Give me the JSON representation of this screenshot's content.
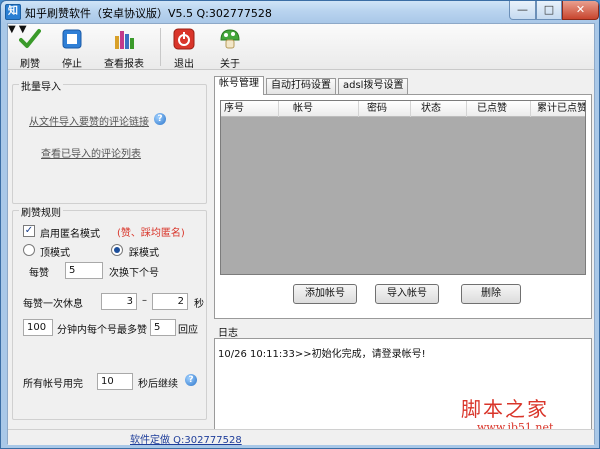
{
  "window": {
    "app_icon_text": "知",
    "title": "知乎刷赞软件（安卓协议版）V5.5   Q:302777528",
    "min_symbol": "—",
    "max_symbol": "□",
    "close_symbol": "✕"
  },
  "toolbar": {
    "items": [
      {
        "label": "刷赞",
        "icon": "checkmark-icon",
        "color": "#3a9a2a"
      },
      {
        "label": "停止",
        "icon": "stop-icon",
        "color": "#2f7fd6"
      },
      {
        "label": "查看报表",
        "icon": "bar-chart-icon",
        "color": "#c23a8a"
      },
      {
        "label": "退出",
        "icon": "power-icon",
        "color": "#d9352a"
      },
      {
        "label": "关于",
        "icon": "mushroom-icon",
        "color": "#43a63a"
      }
    ],
    "dropdown_symbol": "▼"
  },
  "batch_import": {
    "title": "批量导入",
    "import_link": "从文件导入要赞的评论链接",
    "help_symbol": "?",
    "view_link": "查看已导入的评论列表"
  },
  "rules": {
    "title": "刷赞规则",
    "anonymous_label": "启用匿名模式",
    "anonymous_checked": true,
    "anonymous_note": "(赞、踩均匿名)",
    "check_symbol": "✓",
    "mode_up": "顶模式",
    "mode_down": "踩模式",
    "selected_mode": "踩模式",
    "per_like_label": "每赞",
    "per_like_value": "5",
    "per_like_suffix": "次换下个号",
    "rest_label": "每赞一次休息",
    "rest_min": "3",
    "rest_dash": "–",
    "rest_max": "2",
    "rest_unit": "秒",
    "limit_value": "100",
    "limit_middle": "分钟内每个号最多赞",
    "limit_count": "5",
    "limit_suffix": "回应",
    "continue_label": "所有帐号用完",
    "continue_value": "10",
    "continue_suffix": "秒后继续",
    "help_symbol": "?"
  },
  "tabs": {
    "items": [
      "帐号管理",
      "自动打码设置",
      "adsl拨号设置"
    ],
    "active": "帐号管理"
  },
  "accounts_table": {
    "columns": [
      "序号",
      "帐号",
      "密码",
      "状态",
      "已点赞",
      "累计已点赞"
    ],
    "rows": []
  },
  "account_buttons": {
    "add": "添加帐号",
    "import": "导入帐号",
    "delete": "删除"
  },
  "log": {
    "title": "日志",
    "lines": [
      "10/26 10:11:33>>初始化完成，请登录帐号!"
    ]
  },
  "footer": {
    "link": "软件定做  Q:302777528"
  },
  "watermark": {
    "title": "脚本之家",
    "url": "www.jb51.net",
    "color": "#d9352a"
  }
}
